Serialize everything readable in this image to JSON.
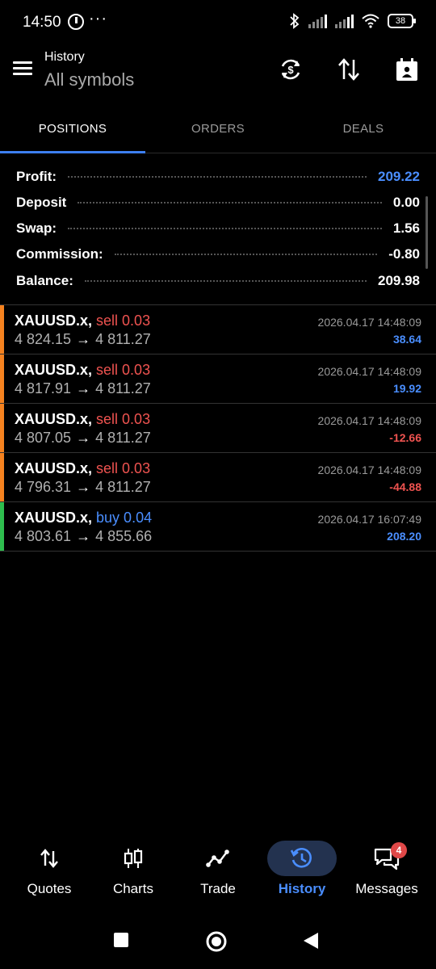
{
  "status_bar": {
    "time": "14:50",
    "dots": "···",
    "battery": "38"
  },
  "header": {
    "title": "History",
    "subtitle": "All symbols",
    "icons": [
      "menu-icon",
      "currency-refresh-icon",
      "sort-icon",
      "calendar-icon"
    ]
  },
  "tabs": [
    {
      "label": "POSITIONS",
      "active": true
    },
    {
      "label": "ORDERS",
      "active": false
    },
    {
      "label": "DEALS",
      "active": false
    }
  ],
  "summary": {
    "profit": {
      "label": "Profit:",
      "value": "209.22"
    },
    "deposit": {
      "label": "Deposit",
      "value": "0.00"
    },
    "swap": {
      "label": "Swap:",
      "value": "1.56"
    },
    "commission": {
      "label": "Commission:",
      "value": "-0.80"
    },
    "balance": {
      "label": "Balance:",
      "value": "209.98"
    }
  },
  "deals": [
    {
      "symbol": "XAUUSD.x,",
      "side": "sell 0.03",
      "type": "sell",
      "open": "4 824.15",
      "arrow": "→",
      "close": "4 811.27",
      "time": "2026.04.17 14:48:09",
      "pl": "38.64"
    },
    {
      "symbol": "XAUUSD.x,",
      "side": "sell 0.03",
      "type": "sell",
      "open": "4 817.91",
      "arrow": "→",
      "close": "4 811.27",
      "time": "2026.04.17 14:48:09",
      "pl": "19.92"
    },
    {
      "symbol": "XAUUSD.x,",
      "side": "sell 0.03",
      "type": "sell",
      "open": "4 807.05",
      "arrow": "→",
      "close": "4 811.27",
      "time": "2026.04.17 14:48:09",
      "pl": "-12.66"
    },
    {
      "symbol": "XAUUSD.x,",
      "side": "sell 0.03",
      "type": "sell",
      "open": "4 796.31",
      "arrow": "→",
      "close": "4 811.27",
      "time": "2026.04.17 14:48:09",
      "pl": "-44.88"
    },
    {
      "symbol": "XAUUSD.x,",
      "side": "buy 0.04",
      "type": "buy",
      "open": "4 803.61",
      "arrow": "→",
      "close": "4 855.66",
      "time": "2026.04.17 16:07:49",
      "pl": "208.20"
    }
  ],
  "bottom_nav": [
    {
      "label": "Quotes",
      "icon": "quotes-arrows-icon",
      "active": false
    },
    {
      "label": "Charts",
      "icon": "candlestick-icon",
      "active": false
    },
    {
      "label": "Trade",
      "icon": "trade-line-icon",
      "active": false
    },
    {
      "label": "History",
      "icon": "history-clock-icon",
      "active": true
    },
    {
      "label": "Messages",
      "icon": "messages-icon",
      "active": false,
      "badge": "4"
    }
  ],
  "colors": {
    "accent": "#4a8eff",
    "sell": "#ef5350",
    "buy": "#4a8eff",
    "profit_positive": "#4a8eff",
    "profit_negative": "#ef5350",
    "sell_bar": "#f5821f",
    "buy_bar": "#2ebd4e",
    "active_tab_bg": "#23324f"
  }
}
